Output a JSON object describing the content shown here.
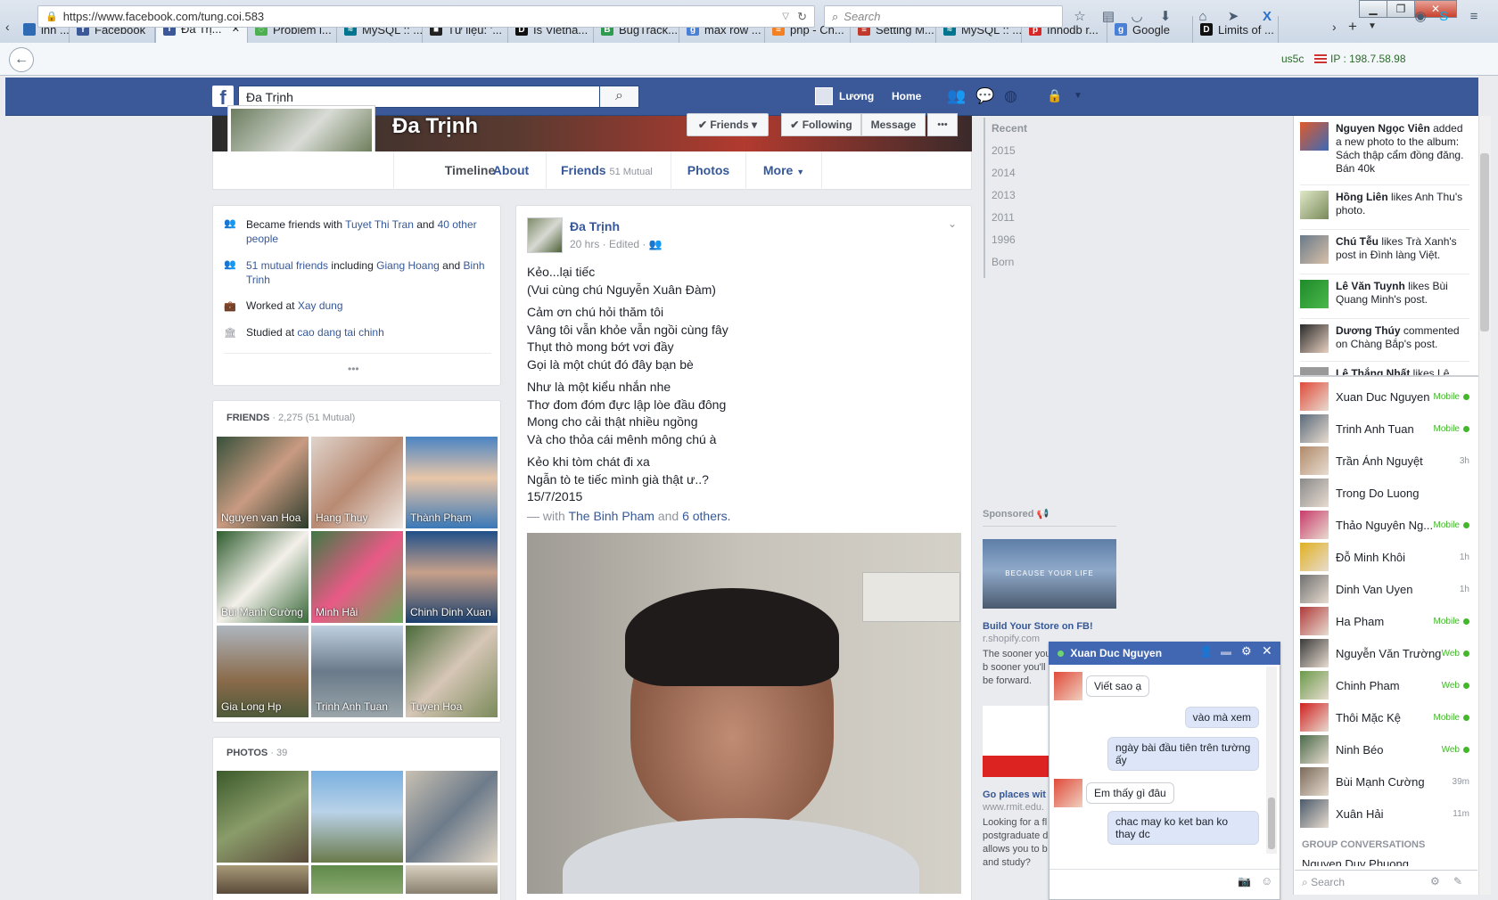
{
  "browser": {
    "tabs": [
      {
        "label": "inh ...",
        "fav": "#2f6ab5"
      },
      {
        "label": "Facebook",
        "fav": "#3b5998",
        "glyph": "f"
      },
      {
        "label": "Đa Trị...",
        "fav": "#3b5998",
        "glyph": "f",
        "active": true
      },
      {
        "label": "Problem l...",
        "fav": "#4caf50",
        "glyph": "◌"
      },
      {
        "label": "MySQL :: ...",
        "fav": "#00758f",
        "glyph": "≈"
      },
      {
        "label": "Tư liệu: '...",
        "fav": "#222",
        "glyph": "■"
      },
      {
        "label": "Is Vietna...",
        "fav": "#111",
        "glyph": "D"
      },
      {
        "label": "BugTrack...",
        "fav": "#2e9b4e",
        "glyph": "B"
      },
      {
        "label": "max row ...",
        "fav": "#4a7fd6",
        "glyph": "g"
      },
      {
        "label": "php - Ch...",
        "fav": "#f48024",
        "glyph": "≡"
      },
      {
        "label": "Setting M...",
        "fav": "#c0392b",
        "glyph": "≡"
      },
      {
        "label": "MySQL :: ...",
        "fav": "#00758f",
        "glyph": "≈"
      },
      {
        "label": "Innodb r...",
        "fav": "#d62828",
        "glyph": "p"
      },
      {
        "label": "Google",
        "fav": "#4a7fd6",
        "glyph": "g"
      },
      {
        "label": "Limits of ...",
        "fav": "#111",
        "glyph": "D"
      }
    ],
    "url": "https://www.facebook.com/tung.coi.583",
    "search_placeholder": "Search",
    "ext_label": "us5c",
    "ip_label": "IP : 198.7.58.98",
    "win_min": "▁",
    "win_max": "❐",
    "win_close": "✕"
  },
  "fb": {
    "search_value": "Đa Trịnh",
    "user_name": "Lương",
    "home_label": "Home"
  },
  "profile": {
    "name": "Đa Trịnh",
    "friends_btn": "Friends",
    "following_btn": "Following",
    "message_btn": "Message",
    "more_dots": "•••",
    "tabs": {
      "timeline": "Timeline",
      "about": "About",
      "friends": "Friends",
      "friends_sub": "51 Mutual",
      "photos": "Photos",
      "more": "More"
    }
  },
  "intro": {
    "l1a": "Became friends with ",
    "l1b": "Tuyet Thi Tran",
    "l1c": " and ",
    "l1d": "40 other people",
    "l2a": "51 mutual friends",
    "l2b": " including ",
    "l2c": "Giang Hoang",
    "l2d": " and ",
    "l2e": "Binh Trinh",
    "l3a": "Worked at ",
    "l3b": "Xay dung",
    "l4a": "Studied at ",
    "l4b": "cao dang tai chinh",
    "dots": "•••"
  },
  "friends_box": {
    "title": "FRIENDS",
    "count": " · 2,275 (51 Mutual)",
    "items": [
      "Nguyen van Hoa",
      "Hang Thuy",
      "Thành Phạm",
      "Bùi Mạnh Cường",
      "Minh Hải",
      "Chinh Dinh Xuan",
      "Gia Long Hp",
      "Trinh Anh Tuan",
      "Tuyen Hoa"
    ]
  },
  "photos_box": {
    "title": "PHOTOS",
    "count": " · 39"
  },
  "post": {
    "author": "Đa Trịnh",
    "meta": "20 hrs · Edited · ",
    "lines": [
      "Kẻo...lại tiếc",
      "(Vui cùng chú Nguyễn Xuân Đàm)",
      "Cảm ơn chú hỏi thăm tôi",
      "Vâng tôi vẫn khỏe vẫn ngồi cùng fây",
      "Thụt thò mong bớt vơi đầy",
      "Gọi là một chút đó đây bạn bè",
      "Như là một kiểu nhắn nhe",
      "Thơ đom đóm đực lập lòe đầu đông",
      "Mong cho cải thật nhiều ngồng",
      "Và cho thỏa cái mênh mông chú à",
      "Kẻo khi tòm chát đi xa",
      "Ngẫn tò te tiếc mình già thật ư..?",
      "15/7/2015"
    ],
    "with_a": "— with ",
    "with_b": "The Binh Pham",
    "with_c": " and ",
    "with_d": "6 others."
  },
  "years": [
    "Recent",
    "2015",
    "2014",
    "2013",
    "2011",
    "1996",
    "Born"
  ],
  "ads": {
    "sponsored": "Sponsored",
    "ad1_img_text": "BECAUSE YOUR LIFE",
    "ad1_title": "Build Your Store on FB!",
    "ad1_url": "r.shopify.com",
    "ad1_text": "The sooner you b sooner you'll be forward.",
    "ad2_title": "Go places wit",
    "ad2_url": "www.rmit.edu.",
    "ad2_text": "Looking for a fl postgraduate d allows you to b and study?"
  },
  "ticker": [
    {
      "name": "Nguyen Ngọc Viên",
      "rest": " added a new photo to the album: Sách thập cẩm đồng đăng. Bán 40k"
    },
    {
      "name": "Hồng Liên",
      "rest": " likes Anh Thu's photo."
    },
    {
      "name": "Chú Tễu",
      "rest": " likes Trà Xanh's post in Đình làng Việt."
    },
    {
      "name": "Lê Văn Tuynh",
      "rest": " likes Bùi Quang Minh's post."
    },
    {
      "name": "Dương Thúy",
      "rest": " commented on Chàng Bắp's post."
    },
    {
      "name": "Lê Thắng Nhất",
      "rest": " likes Lê"
    }
  ],
  "contacts": [
    {
      "name": "Xuan Duc Nguyen",
      "status": "Mobile",
      "online": true
    },
    {
      "name": "Trinh Anh Tuan",
      "status": "Mobile",
      "online": true
    },
    {
      "name": "Trần Ánh Nguyệt",
      "status": "3h",
      "online": false
    },
    {
      "name": "Trong Do Luong",
      "status": "",
      "online": false
    },
    {
      "name": "Thảo Nguyên Ng...",
      "status": "Mobile",
      "online": true
    },
    {
      "name": "Đỗ Minh Khôi",
      "status": "1h",
      "online": false
    },
    {
      "name": "Dinh Van Uyen",
      "status": "1h",
      "online": false
    },
    {
      "name": "Ha Pham",
      "status": "Mobile",
      "online": true
    },
    {
      "name": "Nguyễn Văn Trường",
      "status": "Web",
      "online": true
    },
    {
      "name": "Chinh Pham",
      "status": "Web",
      "online": true
    },
    {
      "name": "Thôi Mặc Kệ",
      "status": "Mobile",
      "online": true
    },
    {
      "name": "Ninh Béo",
      "status": "Web",
      "online": true
    },
    {
      "name": "Bùi Mạnh Cường",
      "status": "39m",
      "online": false
    },
    {
      "name": "Xuân Hải",
      "status": "11m",
      "online": false
    }
  ],
  "group_conv": "GROUP CONVERSATIONS",
  "group_partial": "Nguyen Duy Phuong",
  "sidebar_search": "Search",
  "chat": {
    "name": "Xuan Duc Nguyen",
    "messages": [
      {
        "side": "l",
        "text": "Viết sao ạ"
      },
      {
        "side": "r",
        "text": "vào mà xem"
      },
      {
        "side": "r",
        "text": "ngày bài đầu tiên trên tường ấy"
      },
      {
        "side": "l",
        "text": "Em thấy gì đâu"
      },
      {
        "side": "r",
        "text": "chac may ko ket ban ko thay dc"
      }
    ]
  }
}
